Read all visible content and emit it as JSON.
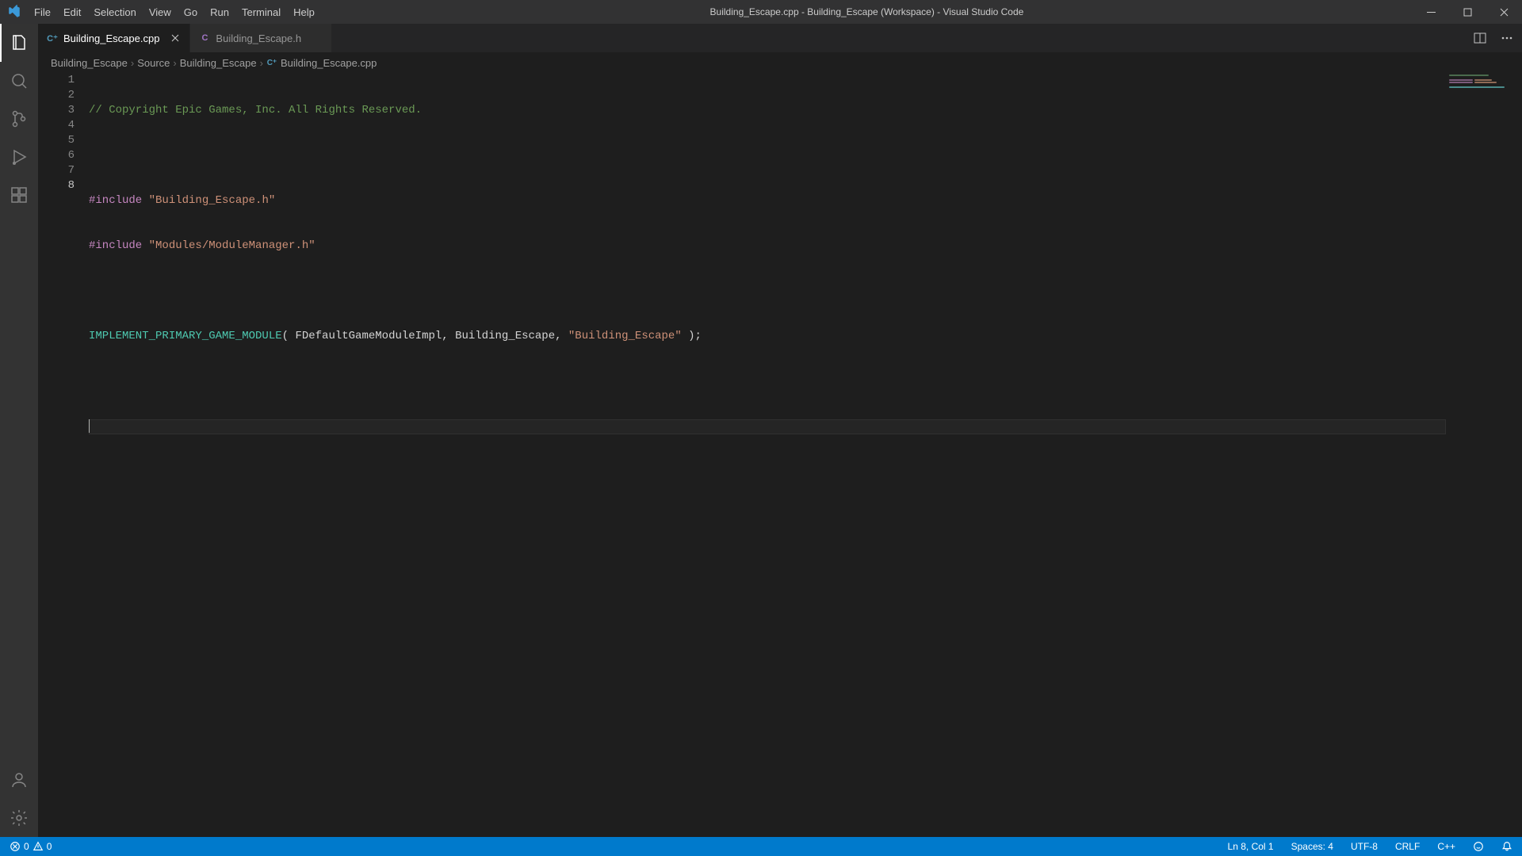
{
  "window": {
    "title": "Building_Escape.cpp - Building_Escape (Workspace) - Visual Studio Code"
  },
  "menu": [
    "File",
    "Edit",
    "Selection",
    "View",
    "Go",
    "Run",
    "Terminal",
    "Help"
  ],
  "tabs": [
    {
      "label": "Building_Escape.cpp",
      "icon_text": "C⁺",
      "icon_color": "#519aba",
      "active": true
    },
    {
      "label": "Building_Escape.h",
      "icon_text": "C",
      "icon_color": "#a074c4",
      "active": false
    }
  ],
  "breadcrumbs": {
    "parts": [
      "Building_Escape",
      "Source",
      "Building_Escape"
    ],
    "file": "Building_Escape.cpp",
    "file_icon_text": "C⁺",
    "file_icon_color": "#519aba"
  },
  "code": {
    "line_count": 8,
    "active_line": 8,
    "lines": {
      "comment": "// Copyright Epic Games, Inc. All Rights Reserved.",
      "include1_kw": "#include",
      "include1_str": "\"Building_Escape.h\"",
      "include2_kw": "#include",
      "include2_str": "\"Modules/ModuleManager.h\"",
      "macro_call": "IMPLEMENT_PRIMARY_GAME_MODULE",
      "macro_args_pre": "( FDefaultGameModuleImpl, Building_Escape, ",
      "macro_str": "\"Building_Escape\"",
      "macro_args_post": " );"
    }
  },
  "status": {
    "errors": "0",
    "warnings": "0",
    "cursor": "Ln 8, Col 1",
    "spaces": "Spaces: 4",
    "encoding": "UTF-8",
    "eol": "CRLF",
    "language": "C++"
  }
}
